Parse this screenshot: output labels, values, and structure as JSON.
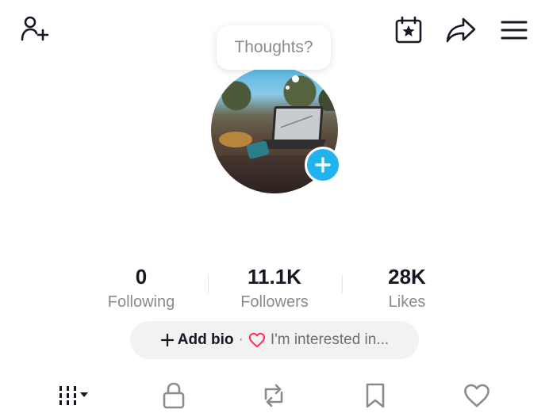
{
  "header": {
    "add_friend_icon": "person-plus-icon",
    "calendar_icon": "calendar-star-icon",
    "share_icon": "share-arrow-icon",
    "menu_icon": "hamburger-menu-icon"
  },
  "bubble": {
    "text": "Thoughts?"
  },
  "avatar": {
    "add_icon": "plus-icon",
    "badge_color": "#20b3ee"
  },
  "stats": [
    {
      "value": "0",
      "label": "Following"
    },
    {
      "value": "11.1K",
      "label": "Followers"
    },
    {
      "value": "28K",
      "label": "Likes"
    }
  ],
  "bio": {
    "add_label": "Add bio",
    "separator": "·",
    "interest_label": "I'm interested in...",
    "heart_color": "#fe2c55"
  },
  "tabs": [
    {
      "icon": "grid-posts-icon"
    },
    {
      "icon": "lock-icon"
    },
    {
      "icon": "repost-icon"
    },
    {
      "icon": "bookmark-icon"
    },
    {
      "icon": "heart-outline-icon"
    }
  ]
}
